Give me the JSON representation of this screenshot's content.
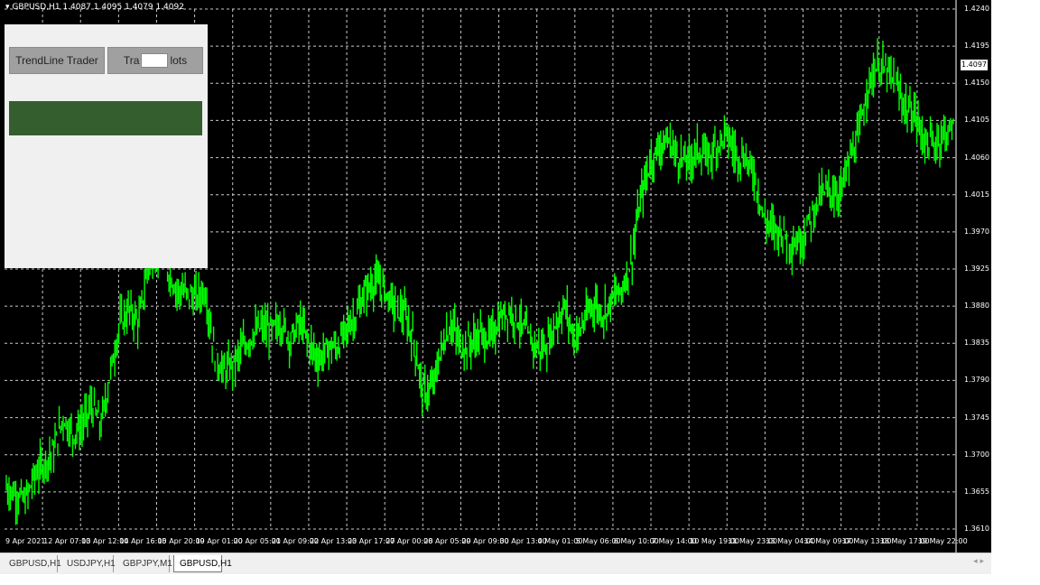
{
  "chart": {
    "symbol_label": "▾ GBPUSD,H1  1.4087 1.4095 1.4079 1.4092",
    "current_price": "1.4097",
    "colors": {
      "background": "#000000",
      "candle": "#00ff00",
      "grid": "#c8c8c8",
      "text": "#ffffff"
    }
  },
  "panel": {
    "trendline_button": "TrendLine Trader",
    "lots_prefix": "Tra",
    "lots_suffix": "lots",
    "lots_value": ""
  },
  "tabs": [
    {
      "label": "GBPUSD,H1",
      "active": false
    },
    {
      "label": "USDJPY,H1",
      "active": false
    },
    {
      "label": "GBPJPY,M1",
      "active": false
    },
    {
      "label": "GBPUSD,H1",
      "active": true
    }
  ],
  "tab_scroll": "◂ ▸",
  "chart_data": {
    "type": "line",
    "title": "GBPUSD,H1",
    "xlabel": "",
    "ylabel": "",
    "y_ticks": [
      "1.4240",
      "1.4195",
      "1.4150",
      "1.4105",
      "1.4060",
      "1.4015",
      "1.3970",
      "1.3925",
      "1.3880",
      "1.3835",
      "1.3790",
      "1.3745",
      "1.3700",
      "1.3655",
      "1.3610"
    ],
    "x_ticks": [
      "9 Apr 2021",
      "12 Apr 07:00",
      "13 Apr 12:00",
      "14 Apr 16:00",
      "15 Apr 20:00",
      "19 Apr 01:00",
      "20 Apr 05:00",
      "21 Apr 09:00",
      "22 Apr 13:00",
      "23 Apr 17:00",
      "27 Apr 00:00",
      "28 Apr 05:00",
      "29 Apr 09:00",
      "30 Apr 13:00",
      "4 May 01:00",
      "5 May 06:00",
      "6 May 10:00",
      "7 May 14:00",
      "10 May 19:00",
      "11 May 23:00",
      "13 May 04:00",
      "14 May 09:00",
      "17 May 13:00",
      "18 May 17:00",
      "19 May 22:00"
    ],
    "ylim": [
      1.361,
      1.424
    ],
    "grid": true,
    "series": [
      {
        "values": [
          1.366,
          1.3652,
          1.3644,
          1.3675,
          1.369,
          1.3705,
          1.3745,
          1.3725,
          1.3735,
          1.376,
          1.3735,
          1.38,
          1.386,
          1.3875,
          1.386,
          1.393,
          1.3945,
          1.3925,
          1.39,
          1.3895,
          1.389,
          1.39,
          1.382,
          1.38,
          1.381,
          1.383,
          1.3845,
          1.3855,
          1.385,
          1.386,
          1.384,
          1.386,
          1.3835,
          1.3815,
          1.383,
          1.383,
          1.3855,
          1.387,
          1.39,
          1.391,
          1.39,
          1.388,
          1.387,
          1.384,
          1.3775,
          1.378,
          1.383,
          1.386,
          1.383,
          1.3835,
          1.3845,
          1.384,
          1.386,
          1.3875,
          1.3865,
          1.3845,
          1.383,
          1.383,
          1.386,
          1.388,
          1.384,
          1.386,
          1.3885,
          1.387,
          1.389,
          1.39,
          1.3935,
          1.401,
          1.4055,
          1.4075,
          1.408,
          1.406,
          1.4055,
          1.407,
          1.406,
          1.4075,
          1.409,
          1.4065,
          1.406,
          1.404,
          1.3985,
          1.3975,
          1.397,
          1.3955,
          1.396,
          1.399,
          1.4015,
          1.402,
          1.4015,
          1.4055,
          1.4085,
          1.415,
          1.417,
          1.4165,
          1.4145,
          1.412,
          1.411,
          1.408,
          1.4075,
          1.409,
          1.4097
        ]
      }
    ]
  }
}
